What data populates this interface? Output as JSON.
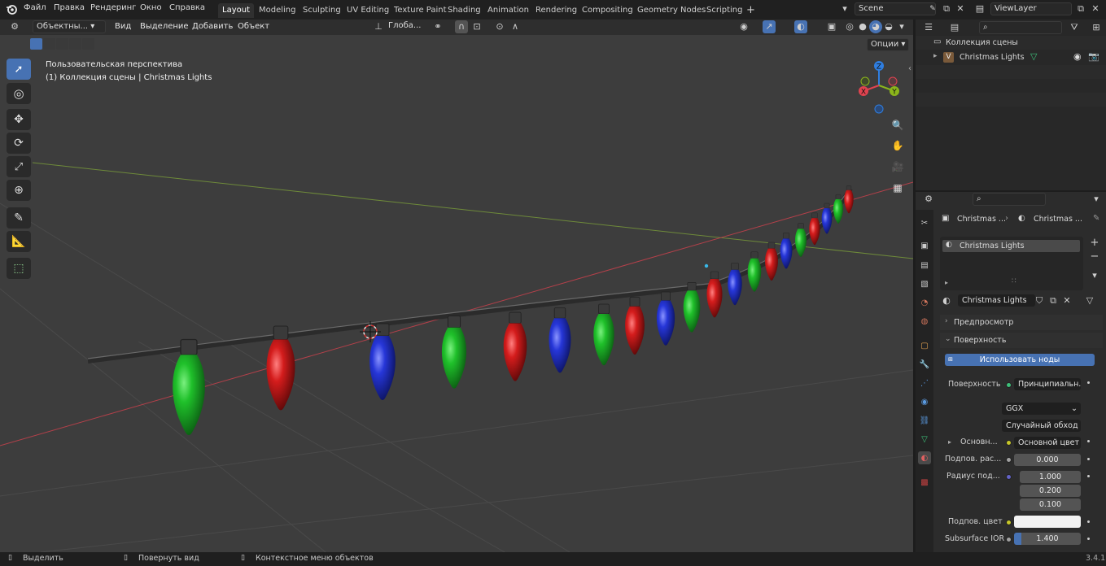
{
  "menubar": {
    "items": [
      "Файл",
      "Правка",
      "Рендеринг",
      "Окно",
      "Справка"
    ],
    "workspaces": [
      "Layout",
      "Modeling",
      "Sculpting",
      "UV Editing",
      "Texture Paint",
      "Shading",
      "Animation",
      "Rendering",
      "Compositing",
      "Geometry Nodes",
      "Scripting"
    ],
    "add_tab": "+",
    "scene_name": "Scene",
    "view_layer": "ViewLayer"
  },
  "viewport": {
    "mode": "Объектны...",
    "menu": [
      "Вид",
      "Выделение",
      "Добавить",
      "Объект"
    ],
    "orientation": "Глоба...",
    "options_label": "Опции",
    "overlay_line1": "Пользовательская перспектива",
    "overlay_line2": "(1) Коллекция сцены | Christmas Lights",
    "gizmo": {
      "x": "X",
      "y": "Y",
      "z": "Z"
    },
    "bulb_colors": [
      "#1fc02a",
      "#d41c1c",
      "#2636d8"
    ]
  },
  "outliner": {
    "collection": "Коллекция сцены",
    "object": "Christmas Lights"
  },
  "properties": {
    "breadcrumb_1": "Christmas ...",
    "breadcrumb_2": "Christmas ...",
    "slot": "Christmas Lights",
    "material": "Christmas Lights",
    "sections": {
      "preview": "Предпросмотр",
      "surface": "Поверхность"
    },
    "use_nodes": "Использовать ноды",
    "surface_label": "Поверхность",
    "surface_value": "Принципиальн...",
    "distribution": "GGX",
    "subsurface_method": "Случайный обход",
    "base_label": "Основн...",
    "base_value": "Основной цвет",
    "ss_weight_label": "Подпов. рас...",
    "ss_weight": "0.000",
    "ss_radius_label": "Радиус под...",
    "ss_radius": [
      "1.000",
      "0.200",
      "0.100"
    ],
    "ss_color_label": "Подпов. цвет",
    "ss_ior_label": "Subsurface IOR",
    "ss_ior": "1.400"
  },
  "statusbar": {
    "select": "Выделить",
    "rotate": "Повернуть вид",
    "context": "Контекстное меню объектов",
    "version": "3.4.1"
  },
  "colors": {
    "accent": "#4772b3",
    "x_axis": "#e0434f",
    "y_axis": "#8bb51b",
    "z_axis": "#2f7ee0"
  }
}
